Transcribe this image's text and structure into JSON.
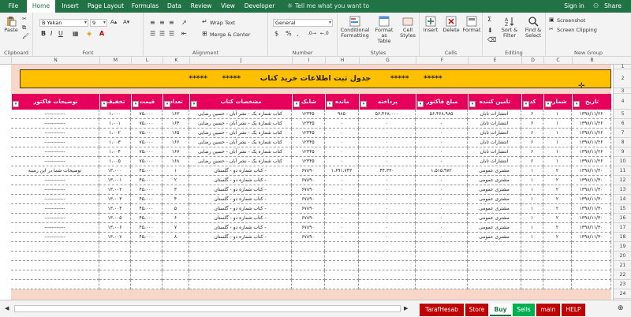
{
  "tabs": [
    "File",
    "Home",
    "Insert",
    "Page Layout",
    "Formulas",
    "Data",
    "Review",
    "View",
    "Developer"
  ],
  "tell_me": "Tell me what you want to do...",
  "user": "Sign in",
  "share": "Share",
  "ribbon": {
    "paste": "Paste",
    "clipboard": "Clipboard",
    "font_name": "B Yekan",
    "font_size": "9",
    "font": "Font",
    "wrap_text": "Wrap Text",
    "merge_center": "Merge & Center",
    "alignment": "Alignment",
    "number_format": "General",
    "number": "Number",
    "conditional": "Conditional",
    "formatting": "Formatting",
    "format_as": "Format as",
    "table": "Table",
    "cell": "Cell",
    "styles_btn": "Styles",
    "styles": "Styles",
    "insert": "Insert",
    "delete": "Delete",
    "format": "Format",
    "cells": "Cells",
    "sort": "Sort &",
    "filter": "Filter",
    "find": "Find &",
    "select": "Select",
    "editing": "Editing",
    "screenshot": "Screenshot",
    "screen_clipping": "Screen Clipping",
    "new_group": "New Group"
  },
  "columns": [
    "N",
    "M",
    "L",
    "K",
    "J",
    "I",
    "H",
    "G",
    "F",
    "E",
    "D",
    "C",
    "B"
  ],
  "rows": [
    "1",
    "2",
    "3",
    "4",
    "5",
    "6",
    "7",
    "8",
    "9",
    "10",
    "11",
    "12",
    "13",
    "14",
    "15",
    "16",
    "17",
    "18",
    "19",
    "20",
    "21",
    "22",
    "23",
    "24",
    "25"
  ],
  "banner": {
    "stars": "*****",
    "title": "جدول ثبت اطلاعات خرید کتاب"
  },
  "headers": [
    "توضیحات فاکتور",
    "تخفیف",
    "قیمت",
    "تعداد",
    "مشخصات کتاب",
    "شابک",
    "مانده",
    "پرداخته",
    "مبلغ فاکتور",
    "تامین کننده",
    "کد",
    "شماره",
    "تاریخ"
  ],
  "table": [
    [
      "------------",
      "۱،۰۰۰",
      "۷۵،۰۰۰",
      "۱۶۳",
      "کتاب شماره یک - نشر آبان - حسین رضایی",
      "۱۲۳۴۵",
      "۹۸۵",
      "۵۶،۴۶۸،۰۰۰",
      "۵۶،۴۶۸،۹۸۵",
      "انتشارات تابان",
      "۶",
      "۱",
      "۱۳۹۸/۱۱/۲۶"
    ],
    [
      "------------",
      "۱،۰۰۱",
      "۷۵،۰۰۰",
      "۱۶۴",
      "کتاب شماره یک - نشر آبان - حسین رضایی",
      "۱۲۳۴۵",
      "۰",
      "۰",
      "۰",
      "انتشارات تابان",
      "۶",
      "۱",
      "۱۳۹۸/۱۱/۲۶"
    ],
    [
      "------------",
      "۱،۰۰۲",
      "۷۵،۰۰۰",
      "۱۶۵",
      "کتاب شماره یک - نشر آبان - حسین رضایی",
      "۱۲۳۴۵",
      "۰",
      "۰",
      "۰",
      "انتشارات تابان",
      "۶",
      "۱",
      "۱۳۹۸/۱۱/۲۶"
    ],
    [
      "------------",
      "۱،۰۰۳",
      "۷۵،۰۰۰",
      "۱۶۶",
      "کتاب شماره یک - نشر آبان - حسین رضایی",
      "۱۲۳۴۵",
      "۰",
      "۰",
      "۰",
      "انتشارات تابان",
      "۶",
      "۱",
      "۱۳۹۸/۱۱/۲۶"
    ],
    [
      "------------",
      "۱،۰۰۴",
      "۷۵،۰۰۰",
      "۱۶۷",
      "کتاب شماره یک - نشر آبان - حسین رضایی",
      "۱۲۳۴۵",
      "۰",
      "۰",
      "۰",
      "انتشارات تابان",
      "۶",
      "۱",
      "۱۳۹۸/۱۱/۲۶"
    ],
    [
      "------------",
      "۱،۰۰۵",
      "۷۵،۰۰۰",
      "۱۶۸",
      "کتاب شماره یک - نشر آبان - حسین رضایی",
      "۱۲۳۴۵",
      "۰",
      "۰",
      "۰",
      "انتشارات تابان",
      "۶",
      "۱",
      "۱۳۹۸/۱۱/۲۶"
    ],
    [
      "توضیحات شما در این زمینه",
      "۱۳،۰۰۰",
      "۴۵،۰۰۰",
      "۱",
      "کتاب شماره دو - گلستان -",
      "۶۷۸۹۰",
      "۱،۶۹۱،۷۴۳",
      "۴۴،۳۳۰",
      "۱،۵۱۵،۹۷۲",
      "مشتری عمومی",
      "۱",
      "۲",
      "۱۳۹۸/۱۱/۳۰"
    ],
    [
      "------------",
      "۱۳،۰۰۱",
      "۴۵،۰۰۰",
      "۲",
      "کتاب شماره دو - گلستان -",
      "۶۷۸۹۰",
      "۰",
      "۰",
      "۰",
      "مشتری عمومی",
      "۱",
      "۲",
      "۱۳۹۸/۱۱/۳۰"
    ],
    [
      "------------",
      "۱۳،۰۰۲",
      "۴۵،۰۰۰",
      "۳",
      "کتاب شماره دو - گلستان -",
      "۶۷۸۹۰",
      "۰",
      "۰",
      "۰",
      "مشتری عمومی",
      "۱",
      "۲",
      "۱۳۹۸/۱۱/۳۰"
    ],
    [
      "------------",
      "۱۳،۰۰۳",
      "۴۵،۰۰۰",
      "۴",
      "کتاب شماره دو - گلستان -",
      "۶۷۸۹۰",
      "۰",
      "۰",
      "۰",
      "مشتری عمومی",
      "۱",
      "۲",
      "۱۳۹۸/۱۱/۳۰"
    ],
    [
      "------------",
      "۱۳،۰۰۴",
      "۴۵،۰۰۰",
      "۵",
      "کتاب شماره دو - گلستان -",
      "۶۷۸۹۰",
      "۰",
      "۰",
      "۰",
      "مشتری عمومی",
      "۱",
      "۲",
      "۱۳۹۸/۱۱/۳۰"
    ],
    [
      "------------",
      "۱۳،۰۰۵",
      "۴۵،۰۰۰",
      "۶",
      "کتاب شماره دو - گلستان -",
      "۶۷۸۹۰",
      "۰",
      "۰",
      "۰",
      "مشتری عمومی",
      "۱",
      "۲",
      "۱۳۹۸/۱۱/۳۰"
    ],
    [
      "------------",
      "۱۳،۰۰۶",
      "۴۵،۰۰۰",
      "۷",
      "کتاب شماره دو - گلستان -",
      "۶۷۸۹۰",
      "۰",
      "۰",
      "۰",
      "مشتری عمومی",
      "۱",
      "۲",
      "۱۳۹۸/۱۱/۳۰"
    ],
    [
      "------------",
      "۱۳،۰۰۷",
      "۴۵،۰۰۰",
      "۸",
      "کتاب شماره دو - گلستان -",
      "۶۷۸۹۰",
      "۰",
      "۰",
      "۰",
      "مشتری عمومی",
      "۱",
      "۲",
      "۱۳۹۸/۱۱/۳۰"
    ]
  ],
  "sheet_tabs": [
    {
      "label": "TarafHesab",
      "color": "#c00000"
    },
    {
      "label": "Store",
      "color": "#c00000"
    },
    {
      "label": "Buy",
      "color": "#ffffff"
    },
    {
      "label": "Sells",
      "color": "#00b050"
    },
    {
      "label": "main",
      "color": "#c00000"
    },
    {
      "label": "HELP",
      "color": "#c00000"
    }
  ],
  "colors": {
    "excel_green": "#217346",
    "header_pink": "#e6005c",
    "banner_yellow": "#ffc000",
    "sheet_bg": "#f9d7c8"
  }
}
